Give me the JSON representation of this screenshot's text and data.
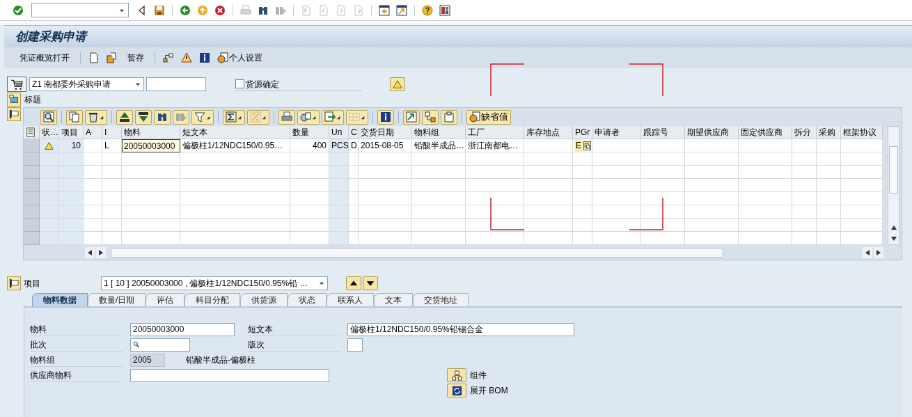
{
  "system_toolbar": {
    "buttons": [
      {
        "kind": "enter",
        "disabled": false
      },
      {
        "kind": "command-field",
        "disabled": false
      },
      {
        "kind": "collapse",
        "disabled": false
      },
      {
        "kind": "save",
        "disabled": false
      },
      {
        "kind": "separator"
      },
      {
        "kind": "back",
        "disabled": false
      },
      {
        "kind": "exit",
        "disabled": false
      },
      {
        "kind": "cancel",
        "disabled": false
      },
      {
        "kind": "separator"
      },
      {
        "kind": "print",
        "disabled": true
      },
      {
        "kind": "find",
        "disabled": false
      },
      {
        "kind": "find-next",
        "disabled": true
      },
      {
        "kind": "separator"
      },
      {
        "kind": "first-page",
        "disabled": true
      },
      {
        "kind": "prev-page",
        "disabled": true
      },
      {
        "kind": "next-page",
        "disabled": true
      },
      {
        "kind": "last-page",
        "disabled": true
      },
      {
        "kind": "separator"
      },
      {
        "kind": "new-session",
        "disabled": false
      },
      {
        "kind": "shortcut",
        "disabled": false
      },
      {
        "kind": "separator"
      },
      {
        "kind": "help",
        "disabled": false
      },
      {
        "kind": "layout",
        "disabled": false
      }
    ]
  },
  "title": "创建采购申请",
  "app_toolbar": [
    {
      "kind": "text",
      "label": "凭证概览打开"
    },
    {
      "kind": "separator"
    },
    {
      "kind": "new-document"
    },
    {
      "kind": "copy-document"
    },
    {
      "kind": "text",
      "label": "暂存"
    },
    {
      "kind": "separator"
    },
    {
      "kind": "structure"
    },
    {
      "kind": "messages"
    },
    {
      "kind": "info"
    },
    {
      "kind": "settings",
      "label": "个人设置"
    }
  ],
  "header": {
    "document_type": "Z1 南都委外采购申请",
    "source_determination": {
      "label": "货源确定",
      "checked": false
    },
    "toggle_label": "标题"
  },
  "grid": {
    "toolbar": [
      {
        "kind": "details",
        "menu": false,
        "disabled": false
      },
      {
        "kind": "separator"
      },
      {
        "kind": "copy",
        "menu": false,
        "disabled": false
      },
      {
        "kind": "delete",
        "menu": true,
        "disabled": false
      },
      {
        "kind": "separator"
      },
      {
        "kind": "sort-ascending",
        "menu": false,
        "disabled": false
      },
      {
        "kind": "sort-descending",
        "menu": false,
        "disabled": false
      },
      {
        "kind": "find",
        "menu": false,
        "disabled": false
      },
      {
        "kind": "find-next",
        "menu": false,
        "disabled": true
      },
      {
        "kind": "filter",
        "menu": true,
        "disabled": false
      },
      {
        "kind": "separator"
      },
      {
        "kind": "sum",
        "menu": true,
        "disabled": false
      },
      {
        "kind": "subtotal",
        "menu": true,
        "disabled": true
      },
      {
        "kind": "separator"
      },
      {
        "kind": "print",
        "menu": false,
        "disabled": false
      },
      {
        "kind": "views",
        "menu": true,
        "disabled": false
      },
      {
        "kind": "export",
        "menu": true,
        "disabled": false
      },
      {
        "kind": "columns",
        "menu": true,
        "disabled": true
      },
      {
        "kind": "separator"
      },
      {
        "kind": "info",
        "menu": false,
        "disabled": false
      },
      {
        "kind": "separator"
      },
      {
        "kind": "transfer",
        "menu": false,
        "disabled": false
      },
      {
        "kind": "compare",
        "menu": false,
        "disabled": false
      },
      {
        "kind": "clipboard",
        "menu": false,
        "disabled": false
      },
      {
        "kind": "separator"
      },
      {
        "kind": "defaults",
        "label": "缺省值",
        "menu": false,
        "disabled": false
      }
    ],
    "columns": [
      "状…",
      "项目",
      "A",
      "I",
      "物料",
      "短文本",
      "数量",
      "Un",
      "C",
      "交货日期",
      "物料组",
      "工厂",
      "库存地点",
      "PGr",
      "申请者",
      "跟踪号",
      "期望供应商",
      "固定供应商",
      "拆分",
      "采购",
      "框架协议"
    ],
    "rows": [
      {
        "warning": true,
        "item": "10",
        "item_category": "L",
        "material": "20050003000",
        "short_text": "偏极柱1/12NDC150/0.95…",
        "quantity": "400",
        "unit": "PCS",
        "date_category": "D",
        "delivery_date": "2015-08-05",
        "material_group": "铅酸半成品…",
        "plant": "浙江南都电…",
        "purchasing_group": "E"
      }
    ]
  },
  "item_detail": {
    "label": "项目",
    "item_selector": "1 [ 10 ] 20050003000 , 偏极柱1/12NDC150/0.95%铅 …",
    "tabs": [
      {
        "label": "物料数据",
        "selected": true
      },
      {
        "label": "数量/日期",
        "selected": false
      },
      {
        "label": "评估",
        "selected": false
      },
      {
        "label": "科目分配",
        "selected": false
      },
      {
        "label": "供货源",
        "selected": false
      },
      {
        "label": "状态",
        "selected": false
      },
      {
        "label": "联系人",
        "selected": false
      },
      {
        "label": "文本",
        "selected": false
      },
      {
        "label": "交货地址",
        "selected": false
      }
    ],
    "fields": [
      {
        "kind": "input",
        "label": "物料",
        "value": "20050003000"
      },
      {
        "kind": "input",
        "label": "短文本",
        "value": "偏极柱1/12NDC150/0.95%铅锡合金"
      },
      {
        "kind": "search",
        "label": "批次"
      },
      {
        "kind": "input",
        "label": "版次"
      },
      {
        "kind": "readonly",
        "label": "物料组",
        "value": "2005",
        "description": "铅酸半成品-偏极柱"
      },
      {
        "kind": "input",
        "label": "供应商物料"
      }
    ],
    "buttons": [
      {
        "kind": "components",
        "label": "组件"
      },
      {
        "kind": "explode",
        "label": "展开 BOM"
      }
    ]
  }
}
